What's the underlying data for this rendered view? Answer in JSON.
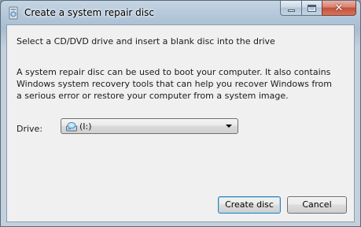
{
  "window": {
    "title": "Create a system repair disc",
    "caption_buttons": {
      "minimize_icon": "minimize-icon",
      "maximize_icon": "maximize-icon",
      "close_glyph": "✕"
    }
  },
  "content": {
    "heading": "Select a CD/DVD drive and insert a blank disc into the drive",
    "description": "A system repair disc can be used to boot your computer. It also contains Windows system recovery tools that can help you recover Windows from a serious error or restore your computer from a system image.",
    "drive_label": "Drive:",
    "drive_value": "(I:)",
    "drive_icon": "optical-drive-icon"
  },
  "buttons": {
    "create_label": "Create disc",
    "cancel_label": "Cancel"
  },
  "colors": {
    "frame_accent": "#a9bdd1",
    "close_button": "#c2513a",
    "default_button_border": "#3c7fb1"
  }
}
